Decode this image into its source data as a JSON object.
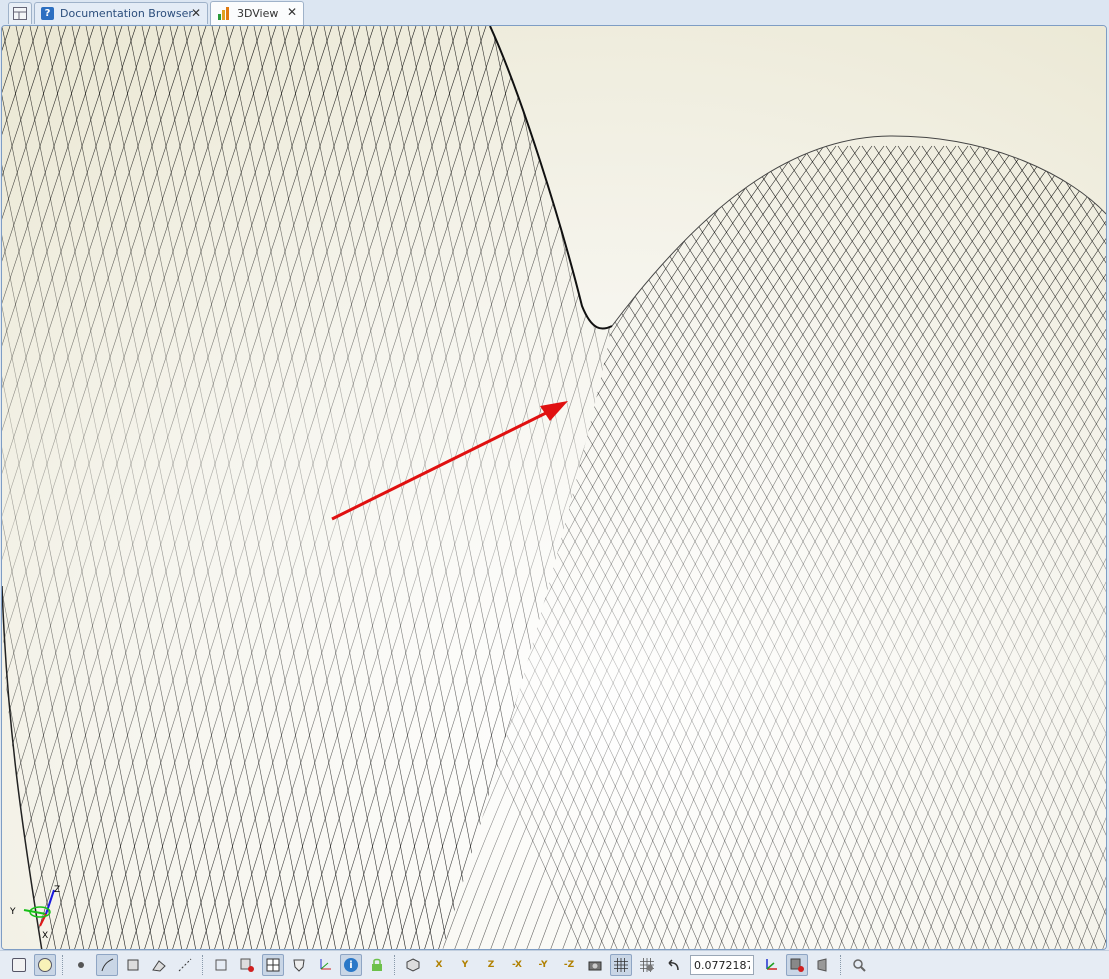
{
  "tabs": [
    {
      "label": "Documentation Browser",
      "icon": "help-icon"
    },
    {
      "label": "3DView",
      "icon": "chart-icon",
      "active": true
    }
  ],
  "toolbar": {
    "zoom_value": "0.0772187",
    "axis_labels": {
      "x": "X",
      "y": "Y",
      "z": "Z",
      "neg_x": "-X",
      "neg_y": "-Y",
      "neg_z": "-Z"
    }
  },
  "triad": {
    "x": "X",
    "y": "Y",
    "z": "Z"
  },
  "colors": {
    "arrow": "#e01010",
    "mesh": "#1a1a1a",
    "background": "#f1efe4"
  }
}
